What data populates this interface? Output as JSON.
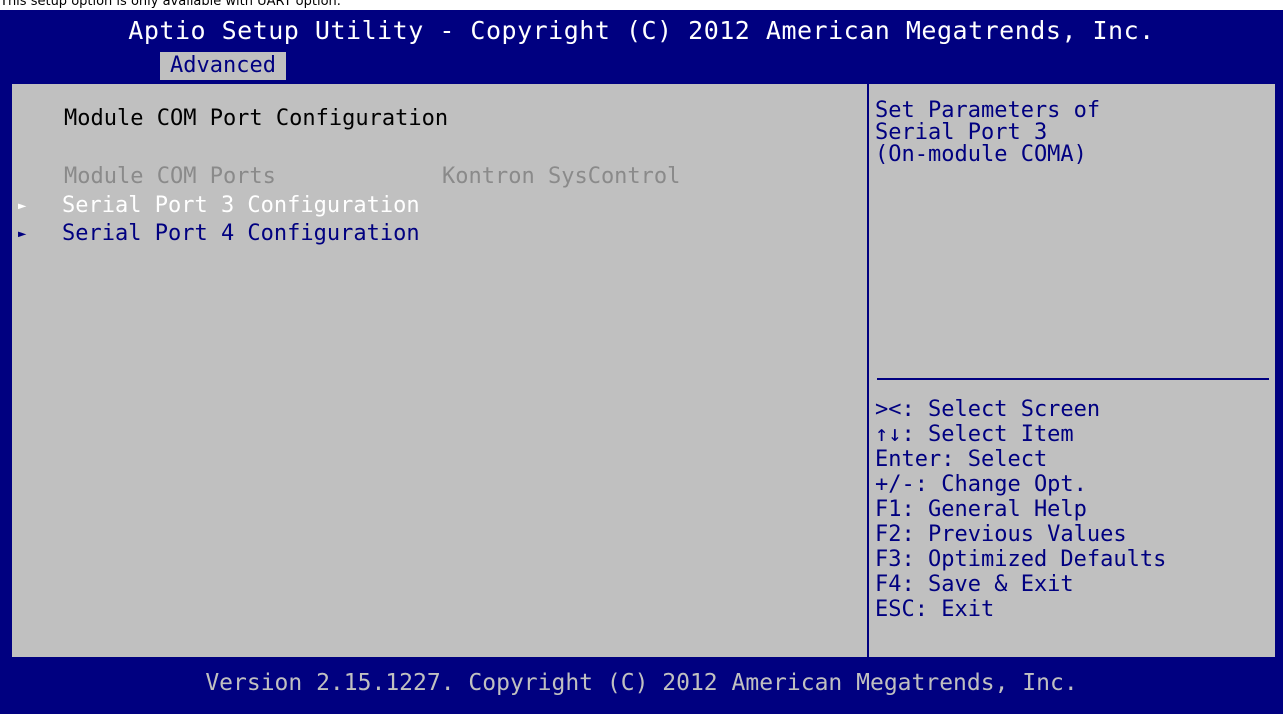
{
  "caption": "This setup option is only available with UART option.",
  "header": {
    "title": "Aptio Setup Utility - Copyright (C) 2012 American Megatrends, Inc.",
    "active_tab": "Advanced"
  },
  "main": {
    "heading": "Module COM Port Configuration",
    "info_row": {
      "label": "Module COM Ports",
      "value": "Kontron SysControl"
    },
    "items": [
      {
        "label": "Serial Port 3 Configuration",
        "selected": true
      },
      {
        "label": "Serial Port 4 Configuration",
        "selected": false
      }
    ]
  },
  "help": {
    "text": "Set Parameters of\nSerial Port 3\n(On-module COMA)"
  },
  "keys": [
    "><: Select Screen",
    "↑↓: Select Item",
    "Enter: Select",
    "+/-: Change Opt.",
    "F1: General Help",
    "F2: Previous Values",
    "F3: Optimized Defaults",
    "F4: Save & Exit",
    "ESC: Exit"
  ],
  "footer": "Version 2.15.1227. Copyright (C) 2012 American Megatrends, Inc.",
  "colors": {
    "background": "#000080",
    "panel": "#c0c0c0",
    "text_blue": "#000080",
    "text_selected": "#ffffff",
    "text_disabled": "#8a8a8a"
  },
  "icons": {
    "submenu": "right-triangle-icon"
  }
}
